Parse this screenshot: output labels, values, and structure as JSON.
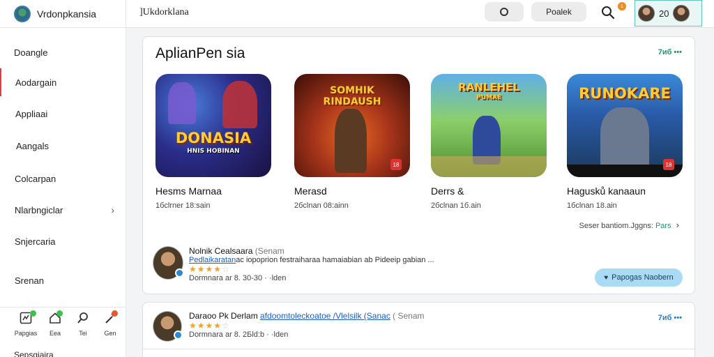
{
  "app": {
    "brand": "Vrdonpkansia",
    "crumb": "]Ukdorklana"
  },
  "toolbar": {
    "publish_label": "Poalek",
    "notif_count": "1",
    "user_number": "20"
  },
  "sidebar": {
    "items": [
      {
        "label": "Doangle"
      },
      {
        "label": "Aodargain"
      },
      {
        "label": "Appliaai"
      },
      {
        "label": "Aangals"
      },
      {
        "label": "Colcarpan"
      },
      {
        "label": "Nlarbngiclar"
      },
      {
        "label": "Snjercaria"
      },
      {
        "label": "Srenan"
      }
    ],
    "bottom_icons": [
      {
        "icon": "dashboard-icon",
        "label": "Papgias"
      },
      {
        "icon": "home-icon",
        "label": "Eea"
      },
      {
        "icon": "search-icon",
        "label": "Tei"
      },
      {
        "icon": "wand-icon",
        "label": "Gen"
      }
    ],
    "footer": "Sepsgiaira"
  },
  "main": {
    "title": "AplianPen sia",
    "more": "7иб •••",
    "games": [
      {
        "name": "Hesms Marnaa",
        "meta": "1бclrner 18:sain",
        "art": "DONASIA",
        "art_sub": "HNIS HOBINAN",
        "age": ""
      },
      {
        "name": "Merasd",
        "meta": "2бclnan 08:ainn",
        "art": "SOMHIK RINDAUSH",
        "art_sub": "",
        "age": "18"
      },
      {
        "name": "Derrs &",
        "meta": "2бclnan 1б.ain",
        "art": "RANLEHEL",
        "art_sub": "PUMAE",
        "age": ""
      },
      {
        "name": "Hagusků kanaaun",
        "meta": "1бclnan 18.ain",
        "art": "RUNOKARE",
        "art_sub": "",
        "age": "18"
      }
    ],
    "see_more": "Seser bantiom.Jggns:",
    "see_more_accent": "Pars",
    "review1": {
      "name": "Nolnik Cealsaara",
      "handle": "(Senam",
      "text_link": "Pedlaikaratan",
      "text": "ac iopoprion festraiharaa hamaiabian ab Pideeip gabian ...",
      "rating": 4,
      "date": "Dormnara ar 8. 30-30 · ·lden",
      "follow": "Papogas Naobern"
    },
    "review2": {
      "name": "Daraoo Pk Derlam",
      "link": "afdoomtoleckoatoe /Vlelsilk (Sanac",
      "handle": "( Senam",
      "rating": 4,
      "date": "Dormnara ar 8. 2Бld:b · ·lden",
      "more": "7иб •••"
    }
  },
  "colors": {
    "accent": "#1f9a6a",
    "active_indicator": "#e23b3b",
    "star": "#f2a22a",
    "follow_bg": "#a9dcf4"
  }
}
